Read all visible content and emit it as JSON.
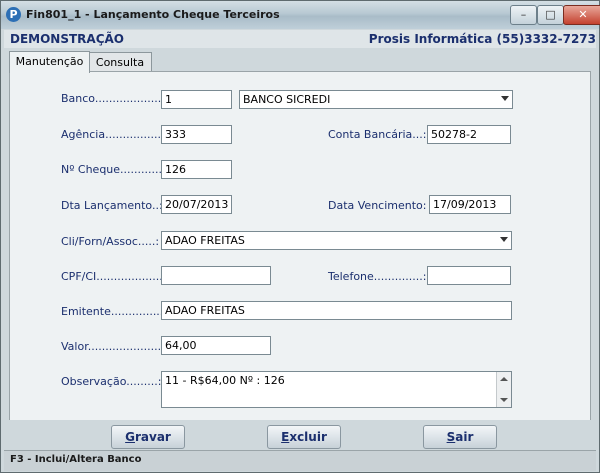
{
  "window": {
    "title": "Fin801_1 - Lançamento Cheque Terceiros",
    "icon_letter": "P",
    "min_label": "–",
    "max_label": "□",
    "close_label": "✕"
  },
  "header": {
    "left": "DEMONSTRAÇÃO",
    "right": "Prosis Informática (55)3332-7273"
  },
  "tabs": [
    {
      "label": "Manutenção",
      "active": true
    },
    {
      "label": "Consulta",
      "active": false
    }
  ],
  "form": {
    "banco_label": "Banco.........................:",
    "banco_code": "1",
    "banco_name": "BANCO SICREDI",
    "agencia_label": "Agência...................:",
    "agencia_value": "333",
    "conta_label": "Conta Bancária...:",
    "conta_value": "50278-2",
    "cheque_label": "Nº Cheque.............:",
    "cheque_value": "126",
    "dta_lanc_label": "Dta Lançamento..:",
    "dta_lanc_value": "20/07/2013",
    "data_venc_label": "Data Vencimento:",
    "data_venc_value": "17/09/2013",
    "cli_label": "Cli/Forn/Assoc.....:",
    "cli_value": "ADAO FREITAS",
    "cpf_label": "CPF/CI......................:",
    "cpf_value": "",
    "telefone_label": "Telefone..............:",
    "telefone_value": "",
    "emitente_label": "Emitente..................:",
    "emitente_value": "ADAO FREITAS",
    "valor_label": "Valor...........................:",
    "valor_value": "64,00",
    "obs_label": "Observação.........:",
    "obs_value": "11 - R$64,00 Nº : 126"
  },
  "buttons": {
    "gravar_underlined": "G",
    "gravar_rest": "ravar",
    "excluir_underlined": "E",
    "excluir_rest": "xcluir",
    "sair_underlined": "S",
    "sair_rest": "air"
  },
  "status": {
    "text": "F3 - Inclui/Altera Banco"
  },
  "icons": {
    "app": "prosis-logo-icon",
    "combo": "chevron-down-icon",
    "scroll_up": "scroll-up-icon",
    "scroll_down": "scroll-down-icon"
  },
  "colors": {
    "label_text": "#1b2f6e",
    "panel_bg": "#eef2f3",
    "window_bg": "#cfd8dc"
  }
}
